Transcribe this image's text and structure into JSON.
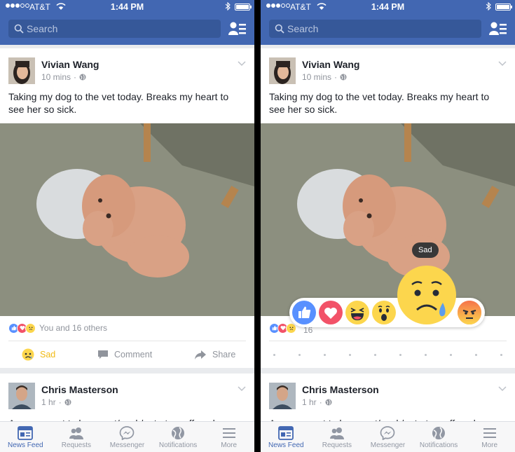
{
  "status": {
    "carrier": "AT&T",
    "time": "1:44 PM"
  },
  "search": {
    "placeholder": "Search"
  },
  "post": {
    "author": "Vivian Wang",
    "time": "10 mins",
    "text": "Taking my dog to the vet today. Breaks my heart to see her so sick.",
    "reactions_text": "You and 16 others",
    "reactions_partial": "16",
    "actions": {
      "sad": "Sad",
      "comment": "Comment",
      "share": "Share"
    }
  },
  "post2": {
    "author": "Chris Masterson",
    "time": "1 hr",
    "text": "Anyone want to hang out/work/eat at a coffee shop"
  },
  "reaction_picker": {
    "tooltip": "Sad",
    "reactions": [
      "like",
      "love",
      "haha",
      "wow",
      "sad",
      "angry"
    ]
  },
  "tabs": [
    {
      "label": "News Feed",
      "icon": "news-feed-icon",
      "active": true
    },
    {
      "label": "Requests",
      "icon": "friend-requests-icon",
      "active": false
    },
    {
      "label": "Messenger",
      "icon": "messenger-icon",
      "active": false
    },
    {
      "label": "Notifications",
      "icon": "globe-icon",
      "active": false
    },
    {
      "label": "More",
      "icon": "hamburger-icon",
      "active": false
    }
  ],
  "colors": {
    "header": "#4267b2",
    "like": "#5890ff",
    "love": "#f25268",
    "reaction_yellow": "#fcd64d",
    "angry": "#f5734a",
    "sad_text": "#f0ba15"
  }
}
